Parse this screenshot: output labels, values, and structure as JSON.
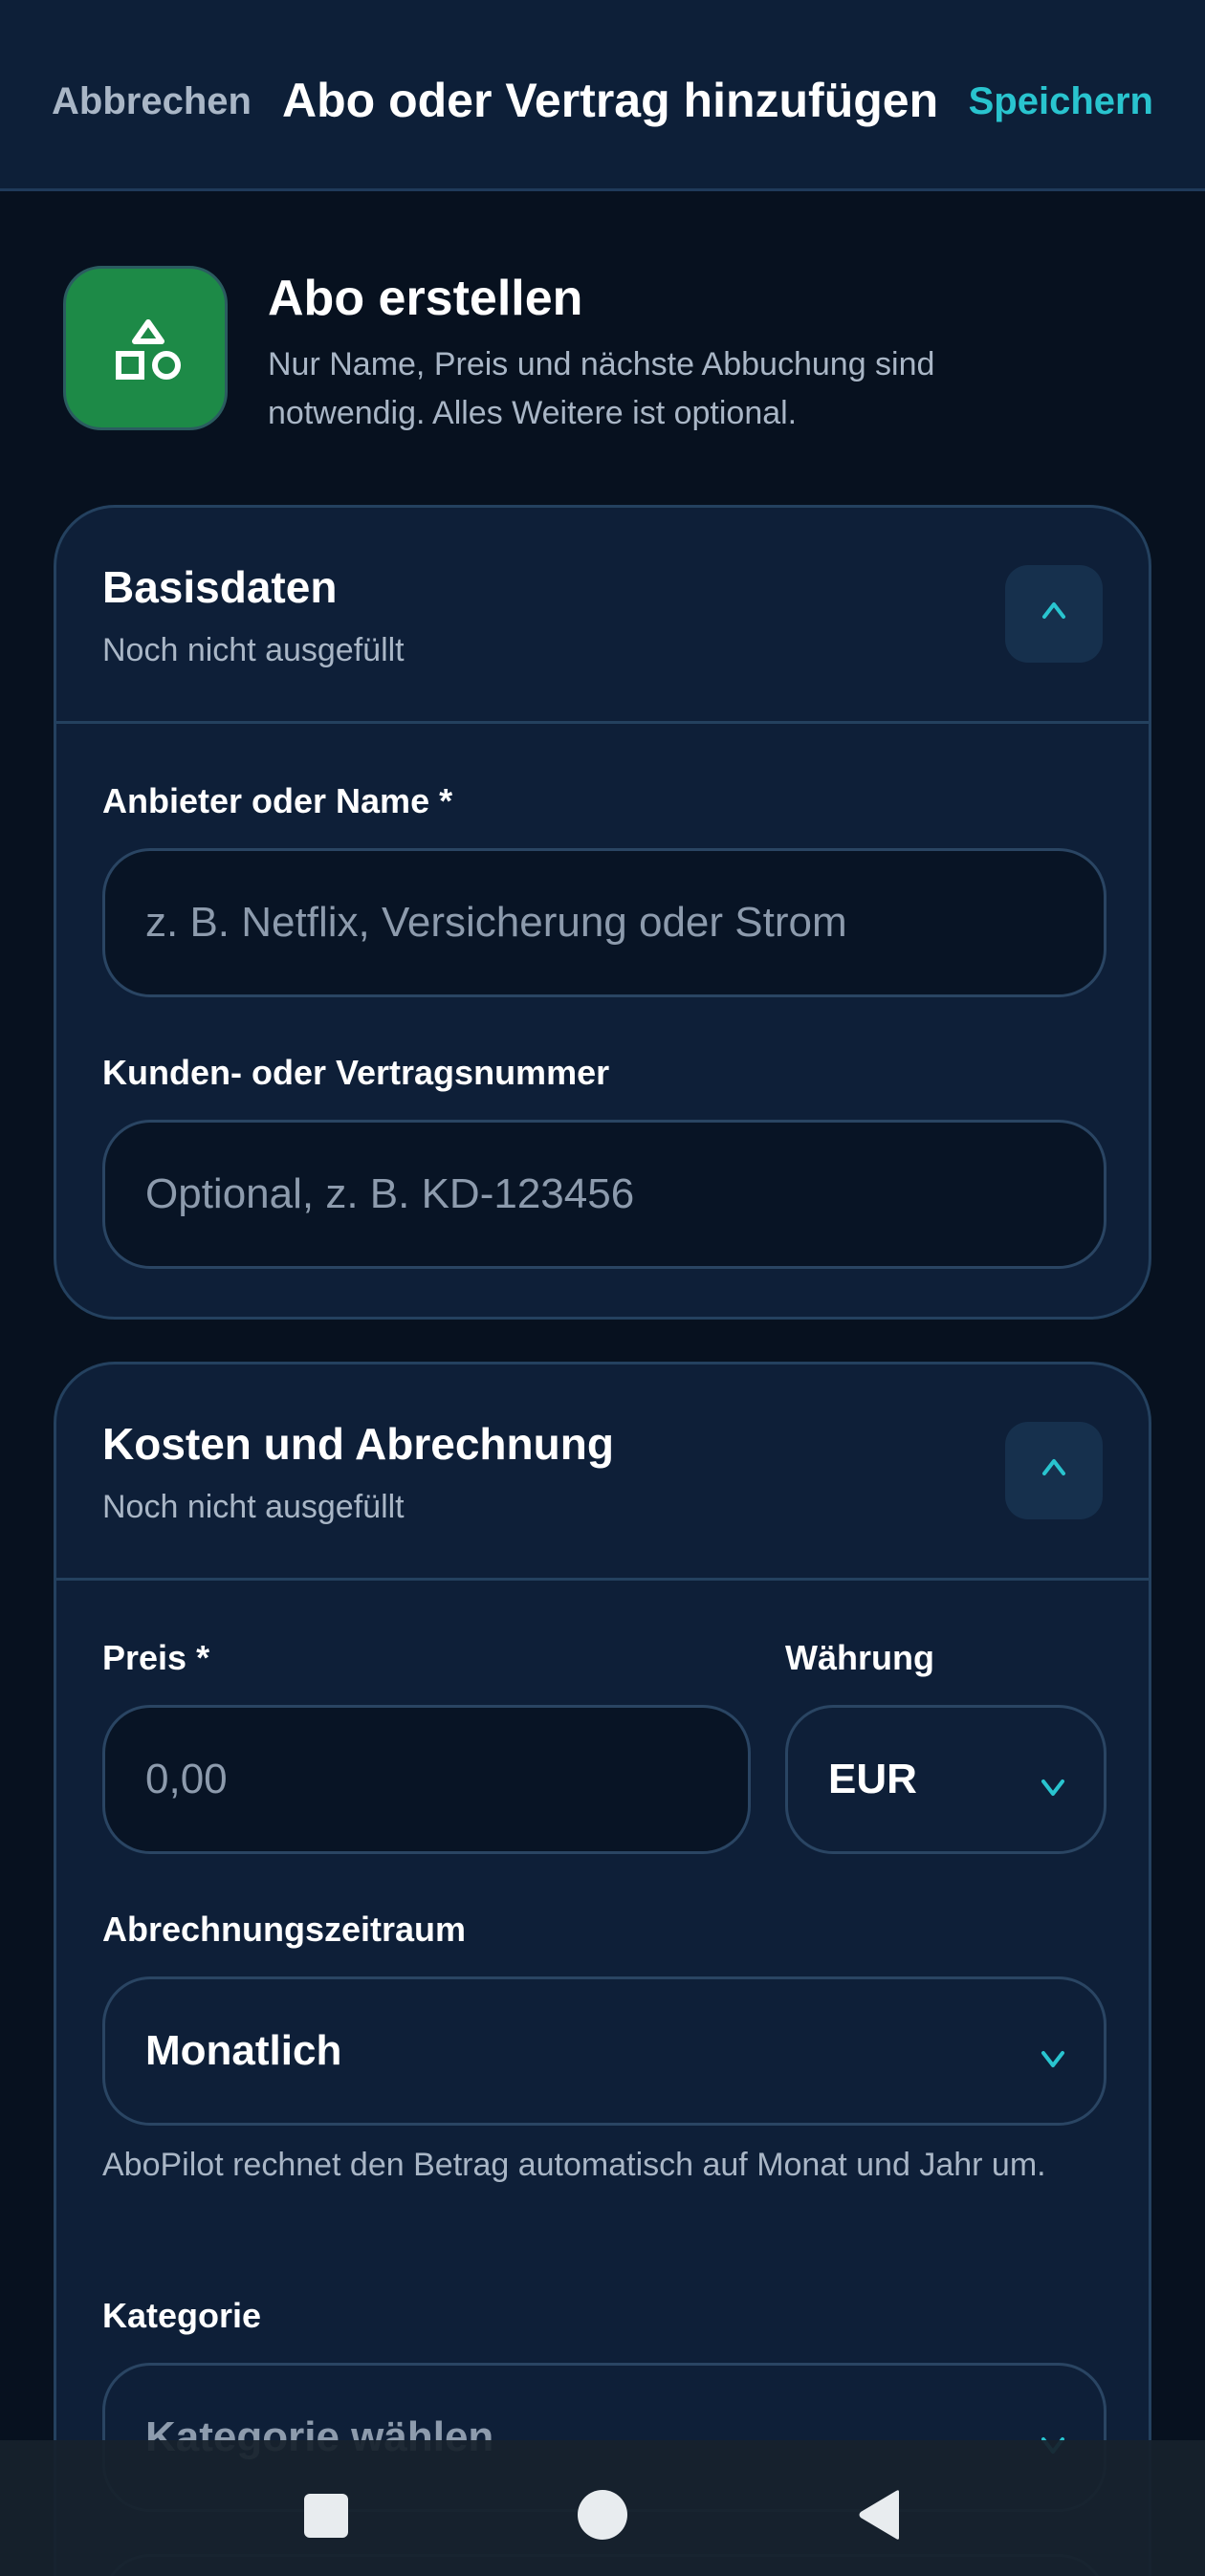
{
  "header": {
    "cancel_label": "Abbrechen",
    "title": "Abo oder Vertrag hinzufügen",
    "save_label": "Speichern"
  },
  "intro": {
    "icon": "shapes-icon",
    "title": "Abo erstellen",
    "description": "Nur Name, Preis und nächste Abbuchung sind notwendig. Alles Weitere ist optional."
  },
  "basisdaten": {
    "title": "Basisdaten",
    "status": "Noch nicht ausgefüllt",
    "collapse_icon": "chevron-up-icon",
    "name_label": "Anbieter oder Name *",
    "name_placeholder": "z. B. Netflix, Versicherung oder Strom",
    "name_value": "",
    "number_label": "Kunden- oder Vertragsnummer",
    "number_placeholder": "Optional, z. B. KD-123456",
    "number_value": ""
  },
  "kosten": {
    "title": "Kosten und Abrechnung",
    "status": "Noch nicht ausgefüllt",
    "collapse_icon": "chevron-up-icon",
    "price_label": "Preis *",
    "price_placeholder": "0,00",
    "price_value": "",
    "currency_label": "Währung",
    "currency_value": "EUR",
    "period_label": "Abrechnungszeitraum",
    "period_value": "Monatlich",
    "period_hint": "AboPilot rechnet den Betrag automatisch auf Monat und Jahr um.",
    "category_label": "Kategorie",
    "category_placeholder": "Kategorie wählen"
  },
  "colors": {
    "accent": "#29c4cf",
    "background": "#07111f",
    "card": "#0e1f38",
    "icon_green": "#1d8a47"
  },
  "system_nav": {
    "icons": [
      "recents-icon",
      "home-icon",
      "back-icon"
    ]
  }
}
